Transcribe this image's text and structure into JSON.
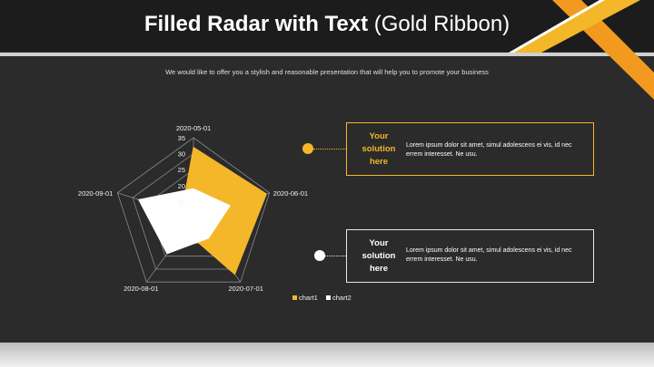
{
  "slide": {
    "title_bold": "Filled Radar with Text",
    "title_rest": "(Gold Ribbon)",
    "subtitle": "We would like to offer you a stylish and reasonable presentation that will help you to promote your business"
  },
  "callouts": [
    {
      "heading": [
        "Your",
        "solution",
        "here"
      ],
      "body": [
        "Lorem ipsum dolor sit amet, simul adolescens ei vis, id nec",
        "errem interesset. Ne usu."
      ]
    },
    {
      "heading": [
        "Your",
        "solution",
        "here"
      ],
      "body": [
        "Lorem ipsum dolor sit amet, simul adolescens ei vis, id nec",
        "errem interesset. Ne usu."
      ]
    }
  ],
  "colors": {
    "accent": "#f4b72a",
    "secondary": "#ffffff",
    "background": "#2b2b2b",
    "title_bar": "#1c1c1c"
  },
  "chart_data": {
    "type": "radar",
    "categories": [
      "2020-05-01",
      "2020-06-01",
      "2020-07-01",
      "2020-08-01",
      "2020-09-01"
    ],
    "ticks": [
      15,
      20,
      25,
      30,
      35
    ],
    "range": [
      10,
      35
    ],
    "series": [
      {
        "name": "chart1",
        "color": "#f4b72a",
        "values": [
          32,
          34,
          32,
          15,
          14
        ]
      },
      {
        "name": "chart2",
        "color": "#ffffff",
        "values": [
          19,
          22,
          18,
          24,
          28
        ]
      }
    ],
    "legend_position": "bottom-right"
  }
}
